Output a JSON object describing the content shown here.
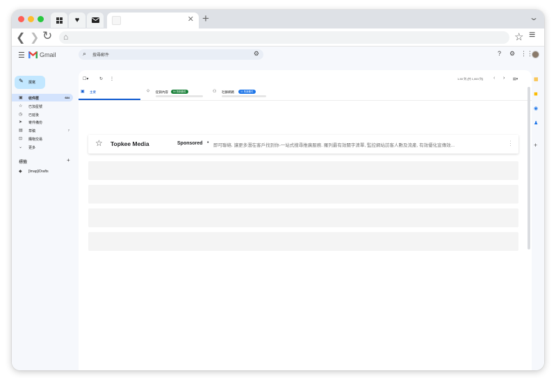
{
  "brand": {
    "gmail_name": "Gmail",
    "gmail_red": "#ea4335",
    "accent": "#0b57d0",
    "compose_bg": "#c2e7ff"
  },
  "search": {
    "placeholder": "搜尋郵件"
  },
  "compose": {
    "label": "撰寫"
  },
  "sidebar": {
    "items": [
      {
        "label": "收件匣",
        "count": "684",
        "icon": "inbox-icon",
        "active": true
      },
      {
        "label": "已加星號",
        "count": "",
        "icon": "star-icon"
      },
      {
        "label": "已延後",
        "count": "",
        "icon": "clock-icon"
      },
      {
        "label": "寄件備份",
        "count": "",
        "icon": "send-icon"
      },
      {
        "label": "草稿",
        "count": "7",
        "icon": "draft-icon"
      },
      {
        "label": "購物交易",
        "count": "",
        "icon": "cart-icon"
      },
      {
        "label": "更多",
        "count": "",
        "icon": "chevron-down-icon"
      }
    ],
    "labels_heading": "標籤",
    "label_items": [
      {
        "label": "[Imap]/Drafts",
        "icon": "label-icon"
      }
    ]
  },
  "toolbar": {
    "pager_text": "1-50 列 (共 1,063 列)"
  },
  "tabs": [
    {
      "label": "主要",
      "badge": "",
      "icon": "inbox-icon"
    },
    {
      "label": "促銷內容",
      "badge": "50 則新郵件",
      "badge_color": "#188038",
      "icon": "tag-icon"
    },
    {
      "label": "社群網路",
      "badge": "11 則新郵件",
      "badge_color": "#1a73e8",
      "icon": "people-icon"
    }
  ],
  "ad": {
    "sender": "Topkee Media",
    "sponsored": "Sponsored",
    "snippet": "即可聯絡. 讓更多潛在客戶找到你-一站式搜尋推廣服務. 羅列最有效關字清單, 監控網站訪客人數及流產, 有效優化宣傳效..."
  }
}
